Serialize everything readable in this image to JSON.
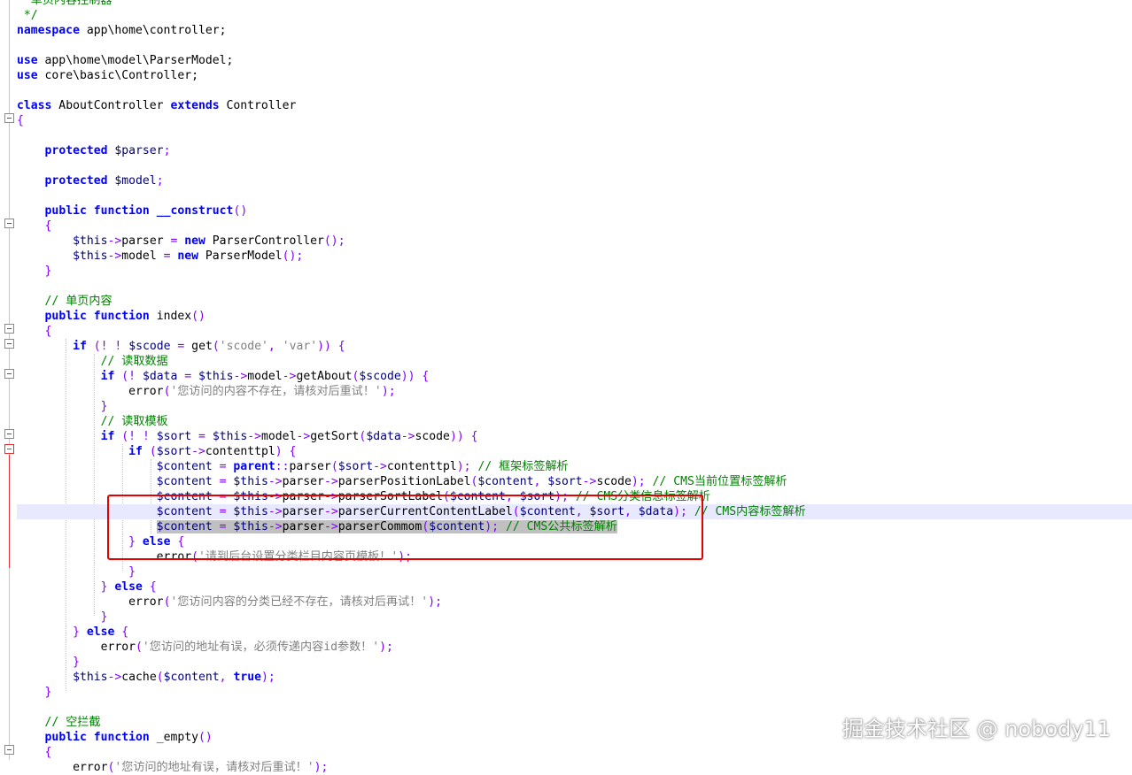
{
  "colors": {
    "keyword": "#0000ff",
    "variable": "#000080",
    "operator": "#8000ff",
    "string": "#808080",
    "comment": "#008000",
    "current_line": "#e8e8ff",
    "selection": "#c0c0c0",
    "highlight_box": "#e60000"
  },
  "editor": {
    "current_line_index": 34,
    "lines": [
      [
        {
          "t": "  单页内容控制器",
          "c": "cm"
        }
      ],
      [
        {
          "t": " */",
          "c": "cm"
        }
      ],
      [
        {
          "t": "namespace",
          "c": "kwb"
        },
        {
          "t": " app\\home\\controller;",
          "c": "id"
        }
      ],
      [],
      [
        {
          "t": "use",
          "c": "kwb"
        },
        {
          "t": " app\\home\\model\\ParserModel;",
          "c": "id"
        }
      ],
      [
        {
          "t": "use",
          "c": "kwb"
        },
        {
          "t": " core\\basic\\Controller;",
          "c": "id"
        }
      ],
      [],
      [
        {
          "t": "class",
          "c": "kwb"
        },
        {
          "t": " AboutController ",
          "c": "id"
        },
        {
          "t": "extends",
          "c": "kwb"
        },
        {
          "t": " Controller",
          "c": "id"
        }
      ],
      [
        {
          "t": "{",
          "c": "op"
        }
      ],
      [],
      [
        {
          "t": "    "
        },
        {
          "t": "protected",
          "c": "kwb"
        },
        {
          "t": " $parser",
          "c": "var"
        },
        {
          "t": ";",
          "c": "op"
        }
      ],
      [],
      [
        {
          "t": "    "
        },
        {
          "t": "protected",
          "c": "kwb"
        },
        {
          "t": " $model",
          "c": "var"
        },
        {
          "t": ";",
          "c": "op"
        }
      ],
      [],
      [
        {
          "t": "    "
        },
        {
          "t": "public",
          "c": "kwb"
        },
        {
          "t": " "
        },
        {
          "t": "function",
          "c": "kwb"
        },
        {
          "t": " __construct",
          "c": "kwb"
        },
        {
          "t": "()",
          "c": "op"
        }
      ],
      [
        {
          "t": "    "
        },
        {
          "t": "{",
          "c": "op"
        }
      ],
      [
        {
          "t": "        "
        },
        {
          "t": "$this",
          "c": "var"
        },
        {
          "t": "->",
          "c": "op"
        },
        {
          "t": "parser ",
          "c": "id"
        },
        {
          "t": "=",
          "c": "op"
        },
        {
          "t": " "
        },
        {
          "t": "new",
          "c": "kwb"
        },
        {
          "t": " ParserController",
          "c": "id"
        },
        {
          "t": "();",
          "c": "op"
        }
      ],
      [
        {
          "t": "        "
        },
        {
          "t": "$this",
          "c": "var"
        },
        {
          "t": "->",
          "c": "op"
        },
        {
          "t": "model ",
          "c": "id"
        },
        {
          "t": "=",
          "c": "op"
        },
        {
          "t": " "
        },
        {
          "t": "new",
          "c": "kwb"
        },
        {
          "t": " ParserModel",
          "c": "id"
        },
        {
          "t": "();",
          "c": "op"
        }
      ],
      [
        {
          "t": "    "
        },
        {
          "t": "}",
          "c": "op"
        }
      ],
      [],
      [
        {
          "t": "    "
        },
        {
          "t": "// 单页内容",
          "c": "cm"
        }
      ],
      [
        {
          "t": "    "
        },
        {
          "t": "public",
          "c": "kwb"
        },
        {
          "t": " "
        },
        {
          "t": "function",
          "c": "kwb"
        },
        {
          "t": " index",
          "c": "id"
        },
        {
          "t": "()",
          "c": "op"
        }
      ],
      [
        {
          "t": "    "
        },
        {
          "t": "{",
          "c": "op"
        }
      ],
      [
        {
          "t": "        "
        },
        {
          "t": "if",
          "c": "kwb"
        },
        {
          "t": " ",
          "c": "id"
        },
        {
          "t": "(!",
          "c": "op"
        },
        {
          "t": " "
        },
        {
          "t": "!",
          "c": "op"
        },
        {
          "t": " "
        },
        {
          "t": "$scode",
          "c": "var"
        },
        {
          "t": " "
        },
        {
          "t": "=",
          "c": "op"
        },
        {
          "t": " get",
          "c": "id"
        },
        {
          "t": "(",
          "c": "op"
        },
        {
          "t": "'scode'",
          "c": "str"
        },
        {
          "t": ",",
          "c": "op"
        },
        {
          "t": " "
        },
        {
          "t": "'var'",
          "c": "str"
        },
        {
          "t": "))",
          "c": "op"
        },
        {
          "t": " "
        },
        {
          "t": "{",
          "c": "op"
        }
      ],
      [
        {
          "t": "            "
        },
        {
          "t": "// 读取数据",
          "c": "cm"
        }
      ],
      [
        {
          "t": "            "
        },
        {
          "t": "if",
          "c": "kwb"
        },
        {
          "t": " "
        },
        {
          "t": "(!",
          "c": "op"
        },
        {
          "t": " "
        },
        {
          "t": "$data",
          "c": "var"
        },
        {
          "t": " "
        },
        {
          "t": "=",
          "c": "op"
        },
        {
          "t": " "
        },
        {
          "t": "$this",
          "c": "var"
        },
        {
          "t": "->",
          "c": "op"
        },
        {
          "t": "model",
          "c": "id"
        },
        {
          "t": "->",
          "c": "op"
        },
        {
          "t": "getAbout",
          "c": "id"
        },
        {
          "t": "(",
          "c": "op"
        },
        {
          "t": "$scode",
          "c": "var"
        },
        {
          "t": "))",
          "c": "op"
        },
        {
          "t": " "
        },
        {
          "t": "{",
          "c": "op"
        }
      ],
      [
        {
          "t": "                "
        },
        {
          "t": "error",
          "c": "id"
        },
        {
          "t": "(",
          "c": "op"
        },
        {
          "t": "'您访问的内容不存在，请核对后重试！'",
          "c": "str"
        },
        {
          "t": ");",
          "c": "op"
        }
      ],
      [
        {
          "t": "            "
        },
        {
          "t": "}",
          "c": "op"
        }
      ],
      [
        {
          "t": "            "
        },
        {
          "t": "// 读取模板",
          "c": "cm"
        }
      ],
      [
        {
          "t": "            "
        },
        {
          "t": "if",
          "c": "kwb"
        },
        {
          "t": " "
        },
        {
          "t": "(!",
          "c": "op"
        },
        {
          "t": " "
        },
        {
          "t": "!",
          "c": "op"
        },
        {
          "t": " "
        },
        {
          "t": "$sort",
          "c": "var"
        },
        {
          "t": " "
        },
        {
          "t": "=",
          "c": "op"
        },
        {
          "t": " "
        },
        {
          "t": "$this",
          "c": "var"
        },
        {
          "t": "->",
          "c": "op"
        },
        {
          "t": "model",
          "c": "id"
        },
        {
          "t": "->",
          "c": "op"
        },
        {
          "t": "getSort",
          "c": "id"
        },
        {
          "t": "(",
          "c": "op"
        },
        {
          "t": "$data",
          "c": "var"
        },
        {
          "t": "->",
          "c": "op"
        },
        {
          "t": "scode",
          "c": "id"
        },
        {
          "t": "))",
          "c": "op"
        },
        {
          "t": " "
        },
        {
          "t": "{",
          "c": "op"
        }
      ],
      [
        {
          "t": "                "
        },
        {
          "t": "if",
          "c": "kwb"
        },
        {
          "t": " "
        },
        {
          "t": "(",
          "c": "op"
        },
        {
          "t": "$sort",
          "c": "var"
        },
        {
          "t": "->",
          "c": "op"
        },
        {
          "t": "contenttpl",
          "c": "id"
        },
        {
          "t": ")",
          "c": "op"
        },
        {
          "t": " "
        },
        {
          "t": "{",
          "c": "op"
        }
      ],
      [
        {
          "t": "                    "
        },
        {
          "t": "$content",
          "c": "var"
        },
        {
          "t": " "
        },
        {
          "t": "=",
          "c": "op"
        },
        {
          "t": " "
        },
        {
          "t": "parent",
          "c": "kwb"
        },
        {
          "t": "::",
          "c": "op"
        },
        {
          "t": "parser",
          "c": "id"
        },
        {
          "t": "(",
          "c": "op"
        },
        {
          "t": "$sort",
          "c": "var"
        },
        {
          "t": "->",
          "c": "op"
        },
        {
          "t": "contenttpl",
          "c": "id"
        },
        {
          "t": ");",
          "c": "op"
        },
        {
          "t": " "
        },
        {
          "t": "// 框架标签解析",
          "c": "cm"
        }
      ],
      [
        {
          "t": "                    "
        },
        {
          "t": "$content",
          "c": "var"
        },
        {
          "t": " "
        },
        {
          "t": "=",
          "c": "op"
        },
        {
          "t": " "
        },
        {
          "t": "$this",
          "c": "var"
        },
        {
          "t": "->",
          "c": "op"
        },
        {
          "t": "parser",
          "c": "id"
        },
        {
          "t": "->",
          "c": "op"
        },
        {
          "t": "parserPositionLabel",
          "c": "id"
        },
        {
          "t": "(",
          "c": "op"
        },
        {
          "t": "$content",
          "c": "var"
        },
        {
          "t": ",",
          "c": "op"
        },
        {
          "t": " "
        },
        {
          "t": "$sort",
          "c": "var"
        },
        {
          "t": "->",
          "c": "op"
        },
        {
          "t": "scode",
          "c": "id"
        },
        {
          "t": ");",
          "c": "op"
        },
        {
          "t": " "
        },
        {
          "t": "// CMS当前位置标签解析",
          "c": "cm"
        }
      ],
      [
        {
          "t": "                    "
        },
        {
          "t": "$content",
          "c": "var"
        },
        {
          "t": " "
        },
        {
          "t": "=",
          "c": "op"
        },
        {
          "t": " "
        },
        {
          "t": "$this",
          "c": "var"
        },
        {
          "t": "->",
          "c": "op"
        },
        {
          "t": "parser",
          "c": "id"
        },
        {
          "t": "->",
          "c": "op"
        },
        {
          "t": "parserSortLabel",
          "c": "id"
        },
        {
          "t": "(",
          "c": "op"
        },
        {
          "t": "$content",
          "c": "var"
        },
        {
          "t": ",",
          "c": "op"
        },
        {
          "t": " "
        },
        {
          "t": "$sort",
          "c": "var"
        },
        {
          "t": ");",
          "c": "op"
        },
        {
          "t": " "
        },
        {
          "t": "// CMS分类信息标签解析",
          "c": "cm"
        }
      ],
      [
        {
          "t": "                    "
        },
        {
          "t": "$content",
          "c": "var"
        },
        {
          "t": " "
        },
        {
          "t": "=",
          "c": "op"
        },
        {
          "t": " "
        },
        {
          "t": "$this",
          "c": "var"
        },
        {
          "t": "->",
          "c": "op"
        },
        {
          "t": "parser",
          "c": "id"
        },
        {
          "t": "->",
          "c": "op"
        },
        {
          "t": "parserCurrentContentLabel",
          "c": "id"
        },
        {
          "t": "(",
          "c": "op"
        },
        {
          "t": "$content",
          "c": "var"
        },
        {
          "t": ",",
          "c": "op"
        },
        {
          "t": " "
        },
        {
          "t": "$sort",
          "c": "var"
        },
        {
          "t": ",",
          "c": "op"
        },
        {
          "t": " "
        },
        {
          "t": "$data",
          "c": "var"
        },
        {
          "t": ");",
          "c": "op"
        },
        {
          "t": " "
        },
        {
          "t": "// CMS内容标签解析",
          "c": "cm"
        }
      ],
      [
        {
          "t": "                    "
        },
        {
          "t": "$content",
          "c": "var",
          "s": 1
        },
        {
          "t": " ",
          "s": 1
        },
        {
          "t": "=",
          "c": "op",
          "s": 1
        },
        {
          "t": " ",
          "s": 1
        },
        {
          "t": "$this",
          "c": "var",
          "s": 1
        },
        {
          "t": "->",
          "c": "op",
          "s": 1
        },
        {
          "t": "parser",
          "c": "id",
          "s": 1
        },
        {
          "t": "->",
          "c": "op",
          "s": 1
        },
        {
          "t": "parserCommom",
          "c": "id",
          "s": 1
        },
        {
          "t": "(",
          "c": "op",
          "s": 1
        },
        {
          "t": "$content",
          "c": "var",
          "s": 1
        },
        {
          "t": ");",
          "c": "op",
          "s": 1
        },
        {
          "t": " ",
          "s": 1
        },
        {
          "t": "// CMS公共标签解析",
          "c": "cm",
          "s": 1
        }
      ],
      [
        {
          "t": "                "
        },
        {
          "t": "}",
          "c": "op"
        },
        {
          "t": " "
        },
        {
          "t": "else",
          "c": "kwb"
        },
        {
          "t": " "
        },
        {
          "t": "{",
          "c": "op"
        }
      ],
      [
        {
          "t": "                    "
        },
        {
          "t": "error",
          "c": "id"
        },
        {
          "t": "(",
          "c": "op"
        },
        {
          "t": "'请到后台设置分类栏目内容页模板！'",
          "c": "str"
        },
        {
          "t": ");",
          "c": "op"
        }
      ],
      [
        {
          "t": "                "
        },
        {
          "t": "}",
          "c": "op"
        }
      ],
      [
        {
          "t": "            "
        },
        {
          "t": "}",
          "c": "op"
        },
        {
          "t": " "
        },
        {
          "t": "else",
          "c": "kwb"
        },
        {
          "t": " "
        },
        {
          "t": "{",
          "c": "op"
        }
      ],
      [
        {
          "t": "                "
        },
        {
          "t": "error",
          "c": "id"
        },
        {
          "t": "(",
          "c": "op"
        },
        {
          "t": "'您访问内容的分类已经不存在，请核对后再试！'",
          "c": "str"
        },
        {
          "t": ");",
          "c": "op"
        }
      ],
      [
        {
          "t": "            "
        },
        {
          "t": "}",
          "c": "op"
        }
      ],
      [
        {
          "t": "        "
        },
        {
          "t": "}",
          "c": "op"
        },
        {
          "t": " "
        },
        {
          "t": "else",
          "c": "kwb"
        },
        {
          "t": " "
        },
        {
          "t": "{",
          "c": "op"
        }
      ],
      [
        {
          "t": "            "
        },
        {
          "t": "error",
          "c": "id"
        },
        {
          "t": "(",
          "c": "op"
        },
        {
          "t": "'您访问的地址有误，必须传递内容id参数！'",
          "c": "str"
        },
        {
          "t": ");",
          "c": "op"
        }
      ],
      [
        {
          "t": "        "
        },
        {
          "t": "}",
          "c": "op"
        }
      ],
      [
        {
          "t": "        "
        },
        {
          "t": "$this",
          "c": "var"
        },
        {
          "t": "->",
          "c": "op"
        },
        {
          "t": "cache",
          "c": "id"
        },
        {
          "t": "(",
          "c": "op"
        },
        {
          "t": "$content",
          "c": "var"
        },
        {
          "t": ",",
          "c": "op"
        },
        {
          "t": " "
        },
        {
          "t": "true",
          "c": "kwb"
        },
        {
          "t": ");",
          "c": "op"
        }
      ],
      [
        {
          "t": "    "
        },
        {
          "t": "}",
          "c": "op"
        }
      ],
      [],
      [
        {
          "t": "    "
        },
        {
          "t": "// 空拦截",
          "c": "cm"
        }
      ],
      [
        {
          "t": "    "
        },
        {
          "t": "public",
          "c": "kwb"
        },
        {
          "t": " "
        },
        {
          "t": "function",
          "c": "kwb"
        },
        {
          "t": " _empty",
          "c": "id"
        },
        {
          "t": "()",
          "c": "op"
        }
      ],
      [
        {
          "t": "    "
        },
        {
          "t": "{",
          "c": "op"
        }
      ],
      [
        {
          "t": "        "
        },
        {
          "t": "error",
          "c": "id"
        },
        {
          "t": "(",
          "c": "op"
        },
        {
          "t": "'您访问的地址有误，请核对后重试！'",
          "c": "str"
        },
        {
          "t": ");",
          "c": "op"
        }
      ]
    ]
  },
  "watermark": {
    "text": "掘金技术社区 @ nobody11"
  }
}
